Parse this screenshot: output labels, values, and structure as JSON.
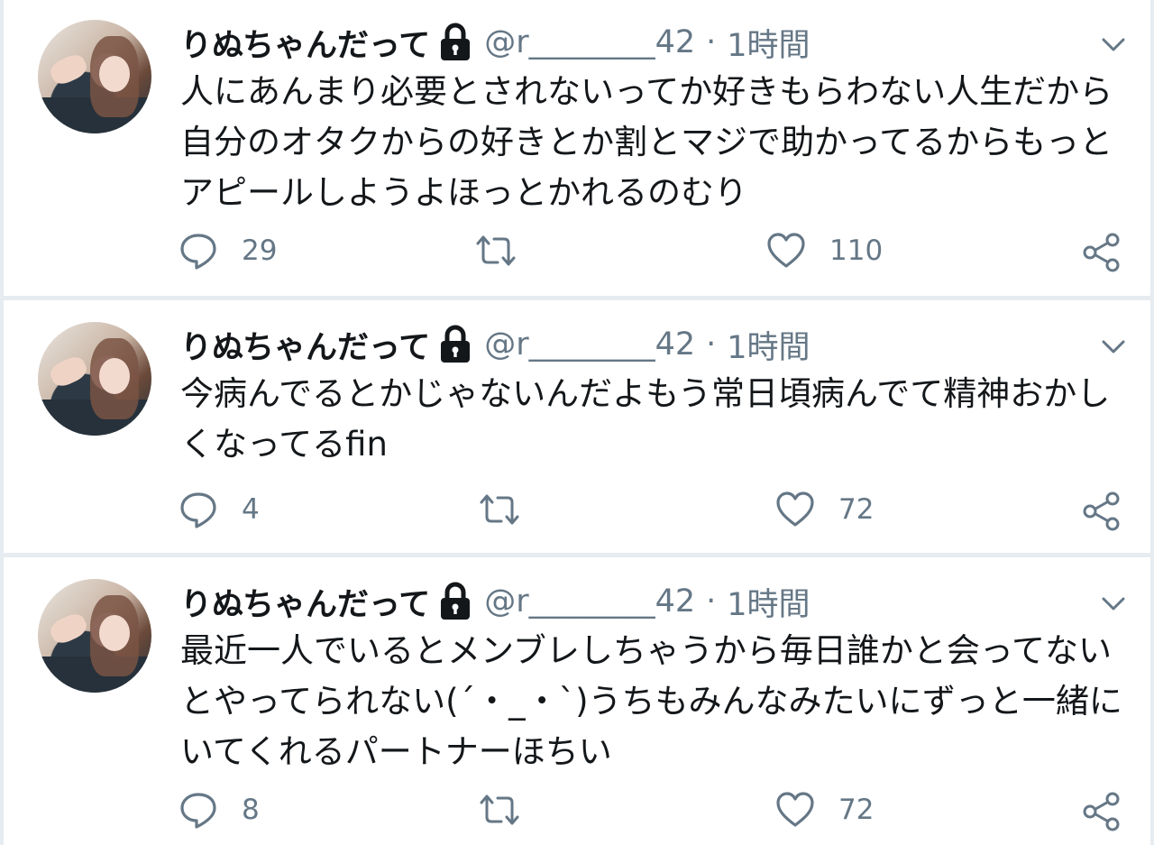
{
  "colors": {
    "background": "#e6ecf0",
    "card": "#ffffff",
    "text": "#14171a",
    "secondary": "#657786"
  },
  "icons": {
    "lock": "lock-icon",
    "more": "chevron-down-icon",
    "reply": "reply-icon",
    "retweet": "retweet-icon",
    "like": "heart-icon",
    "share": "share-icon"
  },
  "tweets": [
    {
      "name": "りぬちゃんだって",
      "handle": "@r________42",
      "separator": "·",
      "time": "1時間",
      "text": "人にあんまり必要とされないってか好きもらわない人生だから自分のオタクからの好きとか割とマジで助かってるからもっとアピールしようよほっとかれるのむり",
      "replies": "29",
      "retweets": "",
      "likes": "110"
    },
    {
      "name": "りぬちゃんだって",
      "handle": "@r________42",
      "separator": "·",
      "time": "1時間",
      "text": "今病んでるとかじゃないんだよもう常日頃病んでて精神おかしくなってるfin",
      "replies": "4",
      "retweets": "",
      "likes": "72"
    },
    {
      "name": "りぬちゃんだって",
      "handle": "@r________42",
      "separator": "·",
      "time": "1時間",
      "text": "最近一人でいるとメンブレしちゃうから毎日誰かと会ってないとやってられない(´・_・`)うちもみんなみたいにずっと一緒にいてくれるパートナーほちい",
      "replies": "8",
      "retweets": "",
      "likes": "72"
    }
  ]
}
